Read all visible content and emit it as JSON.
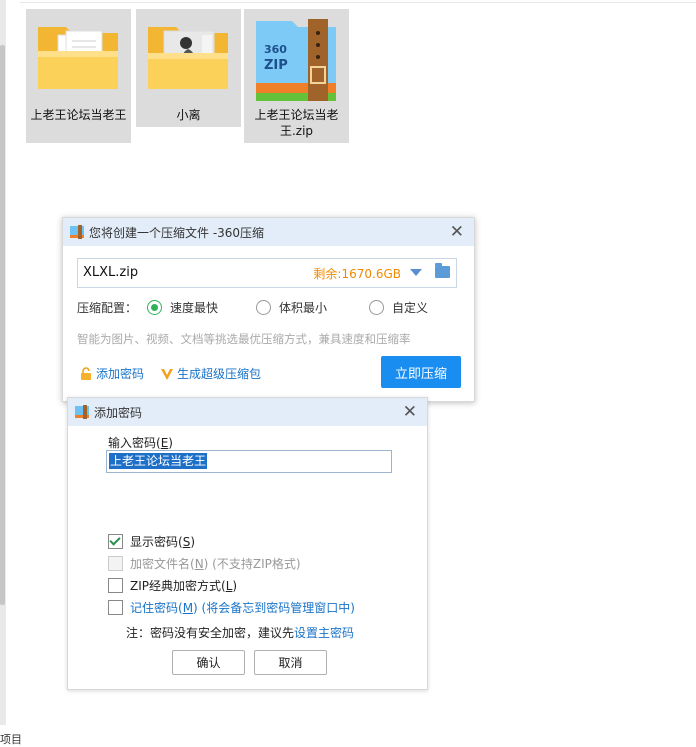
{
  "explorer": {
    "files": [
      {
        "name": "上老王论坛当老王",
        "icon": "folder-with-documents-icon"
      },
      {
        "name": "小离",
        "icon": "folder-with-photo-icon"
      },
      {
        "name": "上老王论坛当老王.zip",
        "icon": "360zip-archive-icon"
      }
    ],
    "status_fragment": "项目"
  },
  "compress_dialog": {
    "title": "您将创建一个压缩文件 -360压缩",
    "filename": "XLXL.zip",
    "space_left": "剩余:1670.6GB",
    "config_label": "压缩配置：",
    "options": [
      {
        "label": "速度最快",
        "selected": true
      },
      {
        "label": "体积最小",
        "selected": false
      },
      {
        "label": "自定义",
        "selected": false
      }
    ],
    "hint": "智能为图片、视频、文档等挑选最优压缩方式，兼具速度和压缩率",
    "add_password": "添加密码",
    "super_pack": "生成超级压缩包",
    "compress_button": "立即压缩"
  },
  "password_dialog": {
    "title": "添加密码",
    "input_label": "输入密码(",
    "input_label_key": "E",
    "input_label_end": ")",
    "password_value": "上老王论坛当老王",
    "show_password": {
      "label": "显示密码(",
      "key": "S",
      "end": ")",
      "checked": true
    },
    "encrypt_filenames": {
      "label": "加密文件名(",
      "key": "N",
      "end": ")",
      "suffix": " (不支持ZIP格式)",
      "checked": false,
      "disabled": true
    },
    "zip_classic": {
      "label": "ZIP经典加密方式(",
      "key": "L",
      "end": ")",
      "checked": false
    },
    "remember": {
      "label": "记住密码(",
      "key": "M",
      "end": ")",
      "suffix": " (将会备忘到密码管理窗口中)",
      "checked": false
    },
    "note": "注：密码没有安全加密，建议先",
    "note_link": "设置主密码",
    "ok": "确认",
    "cancel": "取消"
  }
}
